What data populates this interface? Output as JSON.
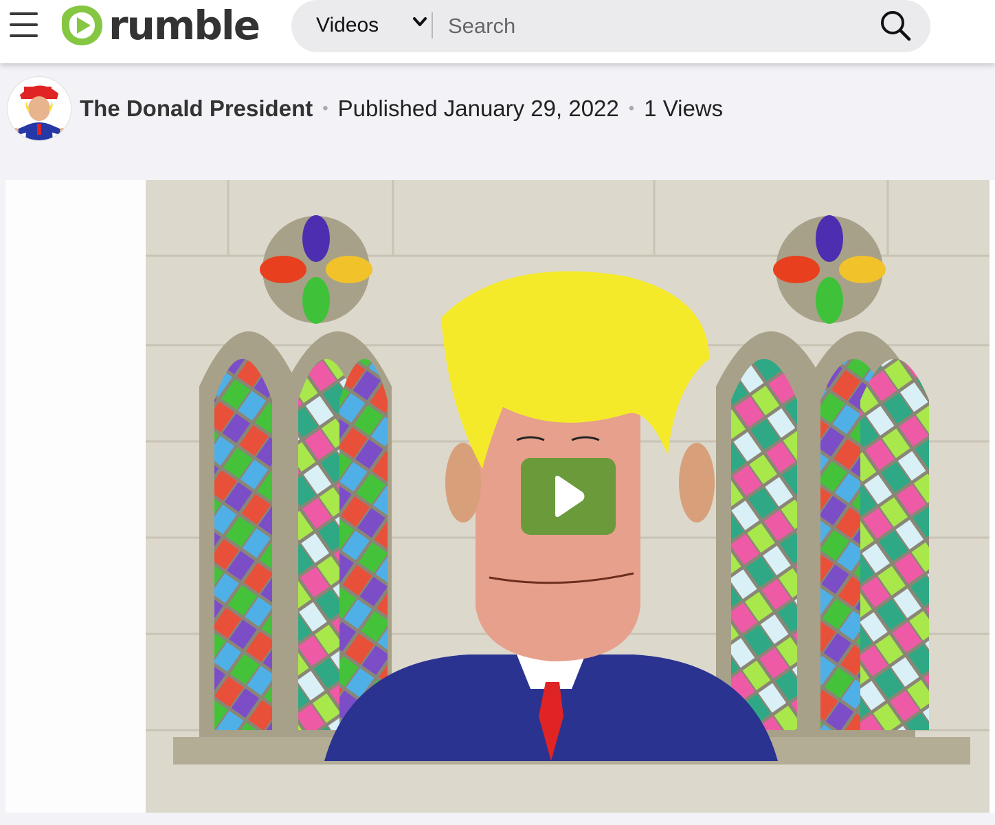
{
  "header": {
    "logo_text": "rumble",
    "category_selected": "Videos",
    "search_placeholder": "Search"
  },
  "video": {
    "channel_name": "The Donald President",
    "separator": "•",
    "published": "Published January 29, 2022",
    "views": "1 Views"
  },
  "colors": {
    "brand_green": "#85c742",
    "play_button": "#6a9a3a",
    "header_bg": "#ffffff",
    "page_bg": "#f2f2f7"
  },
  "icons": [
    "menu-icon",
    "rumble-logo-icon",
    "chevron-down-icon",
    "search-icon",
    "play-icon"
  ]
}
